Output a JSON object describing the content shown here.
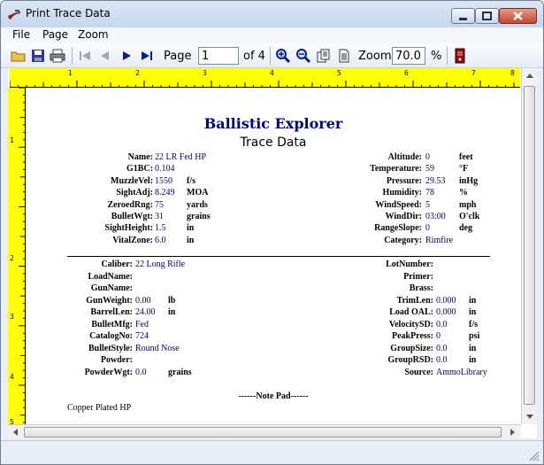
{
  "window": {
    "title": "Print Trace Data"
  },
  "menu": {
    "file": "File",
    "page": "Page",
    "zoom": "Zoom"
  },
  "toolbar": {
    "page_label": "Page",
    "page_value": "1",
    "of_label": "of 4",
    "zoom_label": "Zoom",
    "zoom_value": "70.0",
    "percent_label": "%"
  },
  "ruler": {
    "top_numbers": [
      "1",
      "2",
      "3",
      "4",
      "5",
      "6",
      "7",
      "8"
    ],
    "left_numbers": [
      "1",
      "2",
      "3",
      "4",
      "5"
    ]
  },
  "document": {
    "title": "Ballistic Explorer",
    "subtitle": "Trace Data",
    "left_fields": [
      {
        "label": "Name:",
        "value": "22 LR Fed HP",
        "unit": ""
      },
      {
        "label": "G1BC:",
        "value": "0.104",
        "unit": ""
      },
      {
        "label": "MuzzleVel:",
        "value": "1550",
        "unit": "f/s"
      },
      {
        "label": "SightAdj:",
        "value": "8.249",
        "unit": "MOA"
      },
      {
        "label": "ZeroedRng:",
        "value": "75",
        "unit": "yards"
      },
      {
        "label": "BulletWgt:",
        "value": "31",
        "unit": "grains"
      },
      {
        "label": "SightHeight:",
        "value": "1.5",
        "unit": "in"
      },
      {
        "label": "VitalZone:",
        "value": "6.0",
        "unit": "in"
      }
    ],
    "right_fields": [
      {
        "label": "Altitude:",
        "value": "0",
        "unit": "feet"
      },
      {
        "label": "Temperature:",
        "value": "59",
        "unit": "°F"
      },
      {
        "label": "Pressure:",
        "value": "29.53",
        "unit": "inHg"
      },
      {
        "label": "Humidity:",
        "value": "78",
        "unit": "%"
      },
      {
        "label": "WindSpeed:",
        "value": "5",
        "unit": "mph"
      },
      {
        "label": "WindDir:",
        "value": "03:00",
        "unit": "O'clk"
      },
      {
        "label": "RangeSlope:",
        "value": "0",
        "unit": "deg"
      },
      {
        "label": "Category:",
        "value": "Rimfire",
        "unit": ""
      }
    ],
    "left_fields_2": [
      {
        "label": "Caliber:",
        "value": "22 Long Rifle",
        "unit": ""
      },
      {
        "label": "LoadName:",
        "value": "",
        "unit": ""
      },
      {
        "label": "GunName:",
        "value": "",
        "unit": ""
      },
      {
        "label": "GunWeight:",
        "value": "0.00",
        "unit": "lb"
      },
      {
        "label": "BarrelLen:",
        "value": "24.00",
        "unit": "in"
      },
      {
        "label": "BulletMfg:",
        "value": "Fed",
        "unit": ""
      },
      {
        "label": "CatalogNo:",
        "value": "724",
        "unit": ""
      },
      {
        "label": "BulletStyle:",
        "value": "Round Nose",
        "unit": ""
      },
      {
        "label": "Powder:",
        "value": "",
        "unit": ""
      },
      {
        "label": "PowderWgt:",
        "value": "0.0",
        "unit": "grains"
      }
    ],
    "right_fields_2": [
      {
        "label": "LotNumber:",
        "value": "",
        "unit": ""
      },
      {
        "label": "Primer:",
        "value": "",
        "unit": ""
      },
      {
        "label": "Brass:",
        "value": "",
        "unit": ""
      },
      {
        "label": "TrimLen:",
        "value": "0.000",
        "unit": "in"
      },
      {
        "label": "Load OAL:",
        "value": "0.000",
        "unit": "in"
      },
      {
        "label": "VelocitySD:",
        "value": "0.0",
        "unit": "f/s"
      },
      {
        "label": "PeakPress:",
        "value": "0",
        "unit": "psi"
      },
      {
        "label": "GroupSize:",
        "value": "0.0",
        "unit": "in"
      },
      {
        "label": "GroupRSD:",
        "value": "0.0",
        "unit": "in"
      },
      {
        "label": "Source:",
        "value": "AmmoLibrary",
        "unit": ""
      }
    ],
    "notepad_title": "------Note Pad------",
    "notepad_text": "Copper Plated HP"
  }
}
